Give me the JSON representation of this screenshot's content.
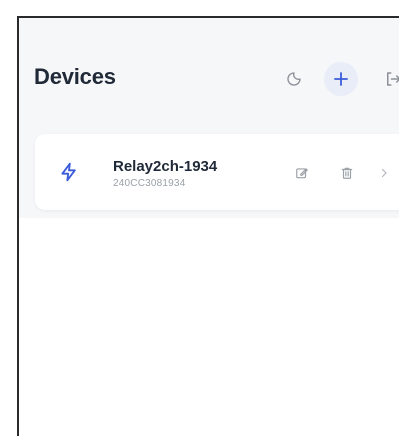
{
  "header": {
    "title": "Devices"
  },
  "icons": {
    "theme": "moon-icon",
    "add": "plus-icon",
    "logout": "logout-icon",
    "device": "lightning-icon",
    "edit": "edit-icon",
    "delete": "trash-icon",
    "open": "chevron-right-icon"
  },
  "colors": {
    "accent": "#3b5bdb",
    "icon_muted": "#9aa0a6",
    "background": "#f6f7f9"
  },
  "devices": [
    {
      "name": "Relay2ch-1934",
      "id": "240CC3081934"
    }
  ]
}
